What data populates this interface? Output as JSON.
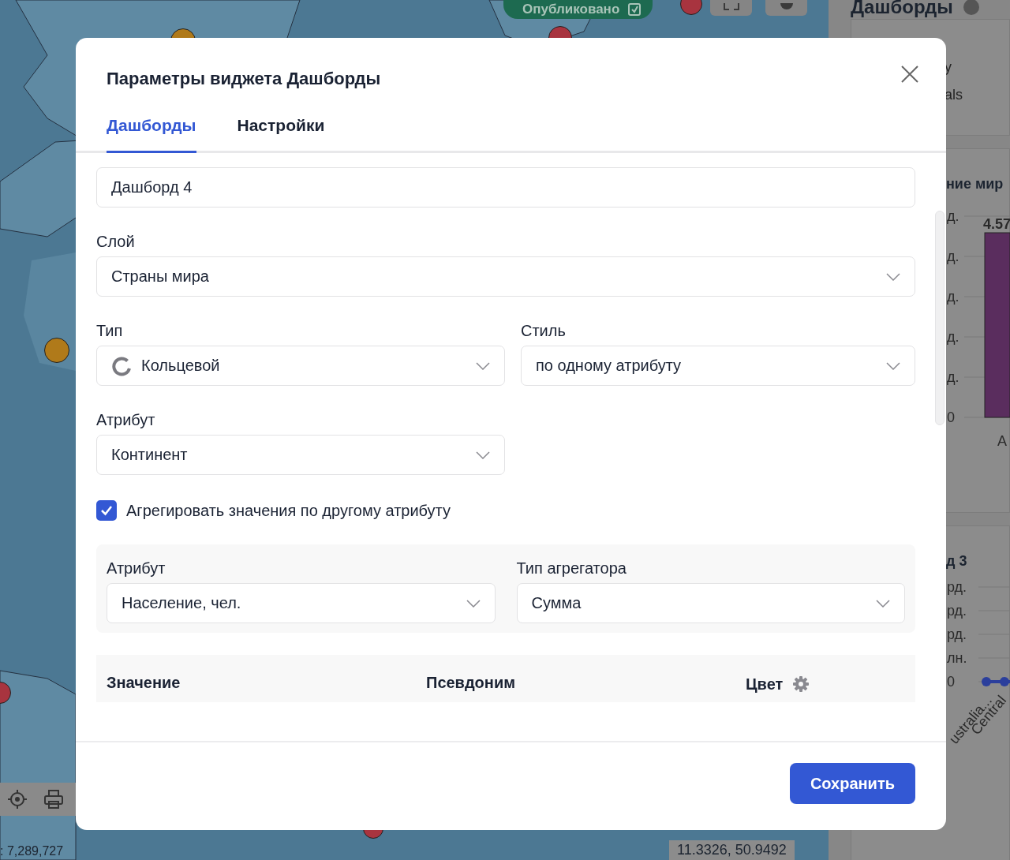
{
  "map": {
    "kind": "picture",
    "publish_button": {
      "label": "Опубликовано"
    },
    "scale": ": 7,289,727",
    "coordinates": "11.3326, 50.9492"
  },
  "side_panel": {
    "title": "Дашборды",
    "card_lines": [
      "y",
      "als"
    ],
    "chart_1": {
      "title": "ние мир",
      "y_labels": [
        "д.",
        "д.",
        "д.",
        "д.",
        "д.",
        "0"
      ],
      "bar_label": "4.57",
      "x_labels": [
        "А"
      ]
    },
    "chart_2": {
      "title": "д 3",
      "y_labels": [
        "рд.",
        "рд.",
        "рд.",
        "лн.",
        "0"
      ],
      "x_labels": [
        "ustralia...",
        "Central"
      ]
    }
  },
  "dialog": {
    "title": "Параметры виджета Дашборды",
    "tabs": [
      {
        "label": "Дашборды",
        "selected": true
      },
      {
        "label": "Настройки",
        "selected": false
      }
    ],
    "name_field": {
      "value": "Дашборд 4"
    },
    "rows": [
      {
        "fields": [
          {
            "label": "Слой",
            "value": "Страны мира",
            "kind": "select"
          }
        ]
      },
      {
        "fields": [
          {
            "label": "Тип",
            "value": "Кольцевой",
            "kind": "type_select"
          },
          {
            "label": "Стиль",
            "value": "по одному атрибуту",
            "kind": "select"
          }
        ]
      },
      {
        "fields": [
          {
            "label": "Атрибут",
            "value": "Континент",
            "kind": "select"
          }
        ]
      }
    ],
    "aggregate": {
      "label": "Агрегировать значения по другому атрибуту",
      "checked": true
    },
    "aggregate_fields": [
      {
        "label": "Атрибут",
        "value": "Население, чел.",
        "kind": "select"
      },
      {
        "label": "Тип агрегатора",
        "value": "Сумма",
        "kind": "select"
      }
    ],
    "table": {
      "columns": [
        "Значение",
        "Псевдоним",
        "Цвет"
      ]
    },
    "save_button": {
      "label": "Сохранить"
    }
  }
}
